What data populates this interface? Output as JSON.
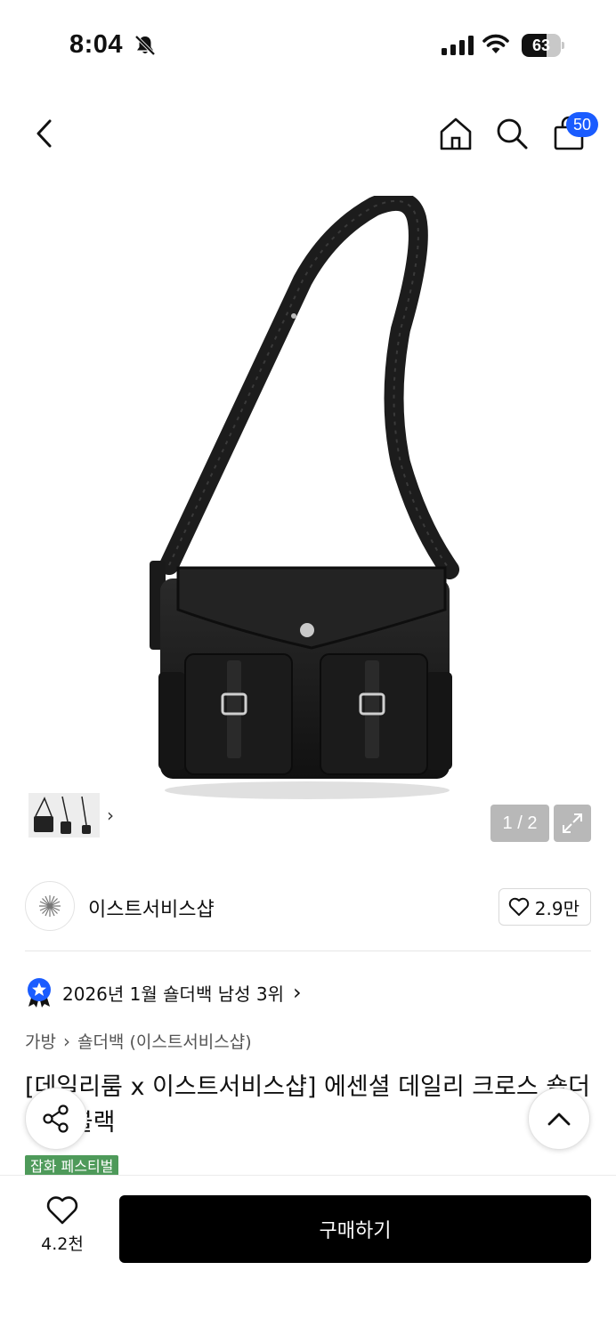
{
  "status_bar": {
    "time": "8:04",
    "battery": "63",
    "battery_level": 0.63
  },
  "header": {
    "cart_badge": "50",
    "icons": [
      "back-icon",
      "home-icon",
      "search-icon",
      "cart-icon"
    ]
  },
  "gallery": {
    "counter": "1 / 2",
    "background": "#f2f2f2"
  },
  "shop": {
    "name": "이스트서비스샵",
    "favorite_count": "2.9만"
  },
  "ranking": {
    "text": "2026년 1월 숄더백 남성 3위"
  },
  "breadcrumb": {
    "category": "가방",
    "subcategory": "숄더백 (이스트서비스샵)"
  },
  "product": {
    "title": "[데일리룸 x 이스트서비스샵] 에센셜 데일리 크로스 숄더백 - 블랙",
    "tag": "잡화 페스티벌"
  },
  "bottom_bar": {
    "like_count": "4.2천",
    "buy_label": "구매하기"
  },
  "colors": {
    "accent": "#1a5cff",
    "tag_green": "#4e9a5a",
    "buy_button": "#000000"
  }
}
